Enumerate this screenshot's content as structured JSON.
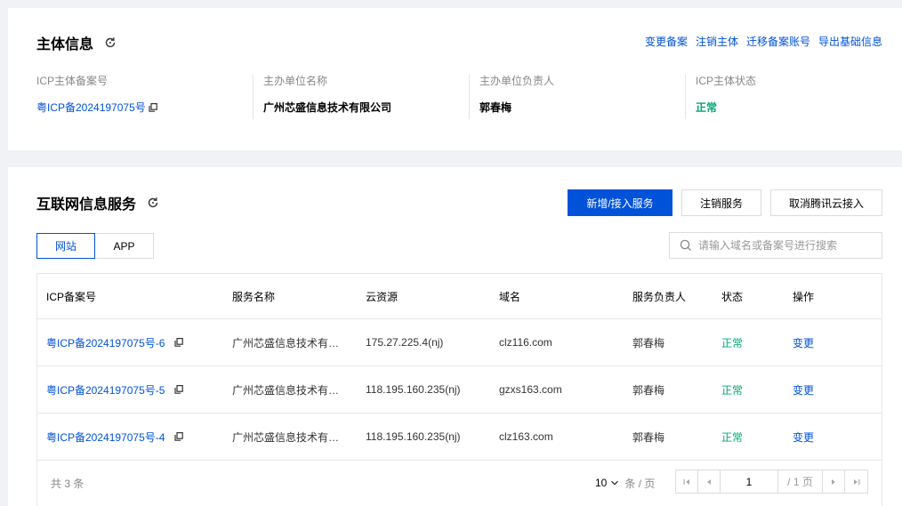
{
  "subject": {
    "title": "主体信息",
    "links": [
      "变更备案",
      "注销主体",
      "迁移备案账号",
      "导出基础信息"
    ],
    "fields": [
      {
        "label": "ICP主体备案号",
        "value": "粤ICP备2024197075号"
      },
      {
        "label": "主办单位名称",
        "value": "广州芯盛信息技术有限公司"
      },
      {
        "label": "主办单位负责人",
        "value": "郭春梅"
      },
      {
        "label": "ICP主体状态",
        "value": "正常"
      }
    ]
  },
  "services": {
    "title": "互联网信息服务",
    "buttons": {
      "add": "新增/接入服务",
      "cancel_service": "注销服务",
      "cancel_access": "取消腾讯云接入"
    },
    "tabs": [
      "网站",
      "APP"
    ],
    "search_placeholder": "请输入域名或备案号进行搜索",
    "columns": [
      "ICP备案号",
      "服务名称",
      "云资源",
      "域名",
      "服务负责人",
      "状态",
      "操作"
    ],
    "rows": [
      {
        "icp": "粤ICP备2024197075号-6",
        "name": "广州芯盛信息技术有限公司",
        "resource": "175.27.225.4(nj)",
        "domain": "clz116.com",
        "owner": "郭春梅",
        "status": "正常",
        "action": "变更"
      },
      {
        "icp": "粤ICP备2024197075号-5",
        "name": "广州芯盛信息技术有限公司",
        "resource": "118.195.160.235(nj)",
        "domain": "gzxs163.com",
        "owner": "郭春梅",
        "status": "正常",
        "action": "变更"
      },
      {
        "icp": "粤ICP备2024197075号-4",
        "name": "广州芯盛信息技术有限公司",
        "resource": "118.195.160.235(nj)",
        "domain": "clz163.com",
        "owner": "郭春梅",
        "status": "正常",
        "action": "变更"
      }
    ],
    "pagination": {
      "total_text": "共 3 条",
      "page_size": "10",
      "page_size_unit": "条 / 页",
      "current_page": "1",
      "total_pages": "/ 1 页"
    }
  },
  "colors": {
    "primary": "#0052d9",
    "success": "#00a870"
  }
}
